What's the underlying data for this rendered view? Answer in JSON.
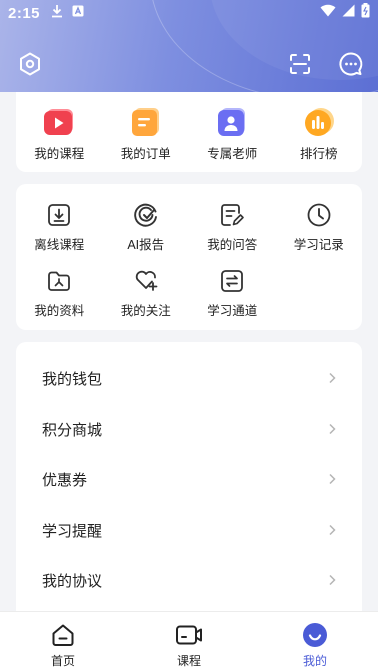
{
  "status_bar": {
    "time": "2:15"
  },
  "quick_access": [
    {
      "label": "我的课程",
      "icon": "video-play-icon",
      "color": "#f0414f"
    },
    {
      "label": "我的订单",
      "icon": "order-icon",
      "color": "#ffa63c"
    },
    {
      "label": "专属老师",
      "icon": "teacher-icon",
      "color": "#6b6ef2"
    },
    {
      "label": "排行榜",
      "icon": "ranking-icon",
      "color": "#ffa822"
    }
  ],
  "tools": [
    {
      "label": "离线课程",
      "icon": "download-icon"
    },
    {
      "label": "AI报告",
      "icon": "ai-report-icon"
    },
    {
      "label": "我的问答",
      "icon": "qa-icon"
    },
    {
      "label": "学习记录",
      "icon": "clock-icon"
    },
    {
      "label": "我的资料",
      "icon": "folder-icon"
    },
    {
      "label": "我的关注",
      "icon": "heart-add-icon"
    },
    {
      "label": "学习通道",
      "icon": "switch-icon"
    }
  ],
  "menu": [
    {
      "label": "我的钱包"
    },
    {
      "label": "积分商城"
    },
    {
      "label": "优惠券"
    },
    {
      "label": "学习提醒"
    },
    {
      "label": "我的协议"
    }
  ],
  "tabbar": [
    {
      "label": "首页",
      "icon": "home-icon",
      "active": false
    },
    {
      "label": "课程",
      "icon": "course-video-icon",
      "active": false
    },
    {
      "label": "我的",
      "icon": "profile-smile-icon",
      "active": true
    }
  ],
  "colors": {
    "accent": "#4a5bd6",
    "header_gradient": [
      "#aab4e9",
      "#5c6fd4"
    ]
  }
}
